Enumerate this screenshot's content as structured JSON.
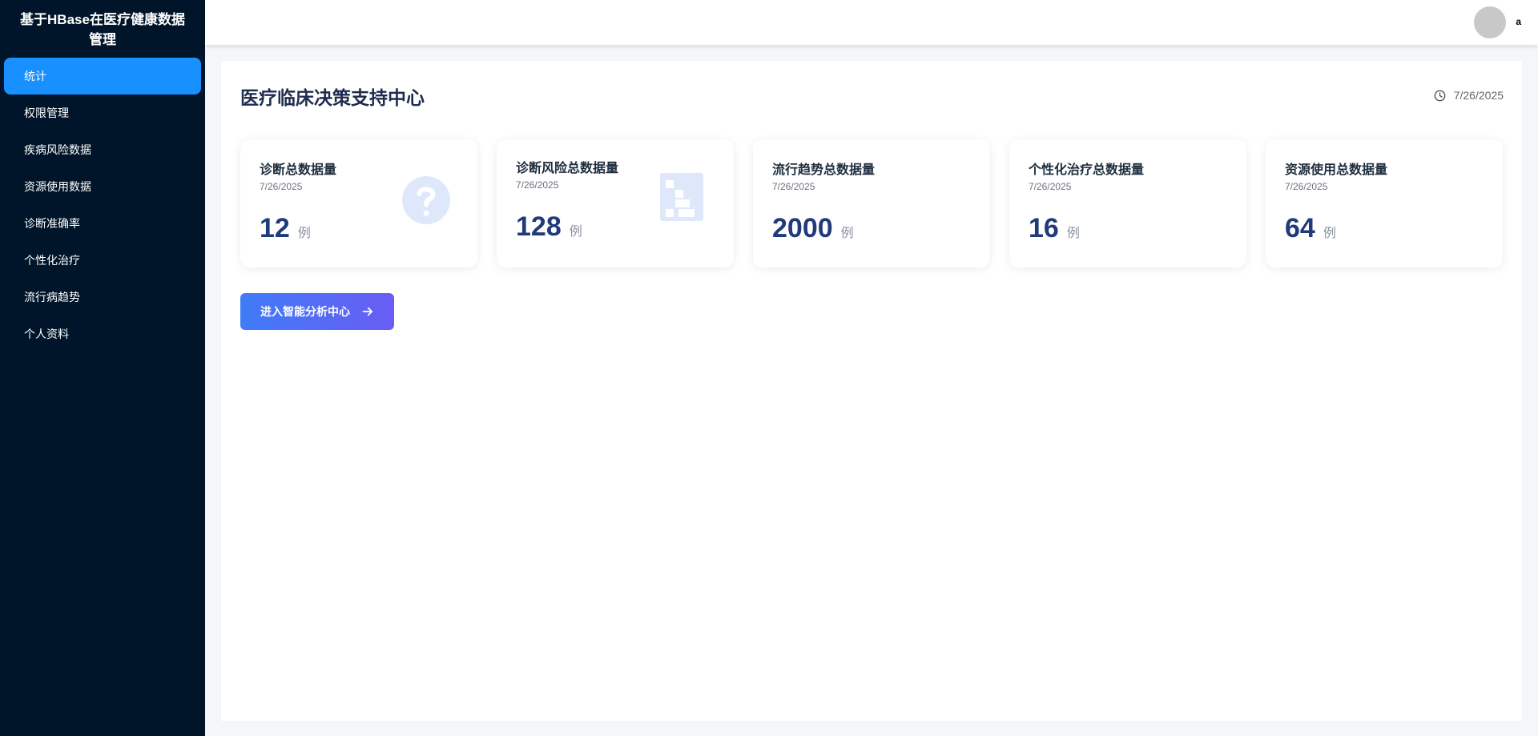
{
  "app": {
    "title": "基于HBase在医疗健康数据管理"
  },
  "sidebar": {
    "items": [
      {
        "label": "统计",
        "active": true
      },
      {
        "label": "权限管理",
        "active": false
      },
      {
        "label": "疾病风险数据",
        "active": false
      },
      {
        "label": "资源使用数据",
        "active": false
      },
      {
        "label": "诊断准确率",
        "active": false
      },
      {
        "label": "个性化治疗",
        "active": false
      },
      {
        "label": "流行病趋势",
        "active": false
      },
      {
        "label": "个人资料",
        "active": false
      }
    ]
  },
  "header": {
    "username": "a"
  },
  "main": {
    "title": "医疗临床决策支持中心",
    "date": "7/26/2025",
    "cards": [
      {
        "title": "诊断总数据量",
        "date": "7/26/2025",
        "value": "12",
        "unit": "例",
        "icon": "question-circle-icon"
      },
      {
        "title": "诊断风险总数据量",
        "date": "7/26/2025",
        "value": "128",
        "unit": "例",
        "icon": "building-icon"
      },
      {
        "title": "流行趋势总数据量",
        "date": "7/26/2025",
        "value": "2000",
        "unit": "例"
      },
      {
        "title": "个性化治疗总数据量",
        "date": "7/26/2025",
        "value": "16",
        "unit": "例"
      },
      {
        "title": "资源使用总数据量",
        "date": "7/26/2025",
        "value": "64",
        "unit": "例"
      }
    ],
    "enter_button": "进入智能分析中心"
  },
  "colors": {
    "sidebar_bg": "#001529",
    "active_item": "#1890ff",
    "title_text": "#1e2d4f",
    "number_text": "#203a7a",
    "button_gradient_start": "#3f7cf7",
    "button_gradient_end": "#6a5cf4"
  }
}
